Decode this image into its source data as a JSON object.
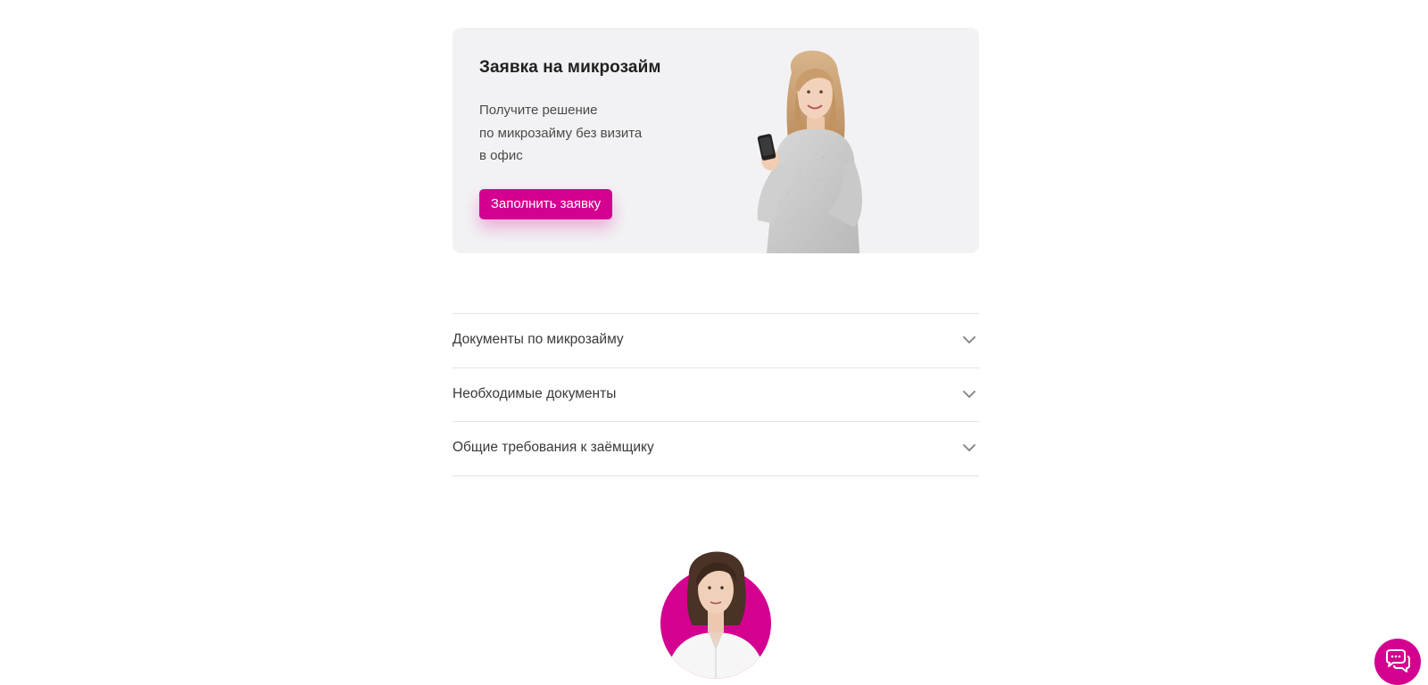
{
  "promo": {
    "title": "Заявка на микрозайм",
    "text_lines": [
      "Получите решение",
      "по микрозайму без визита",
      "в офис"
    ],
    "button_label": "Заполнить заявку",
    "accent_color": "#d4008f",
    "card_background": "#f2f2f4"
  },
  "accordion": {
    "items": [
      {
        "label": "Документы по микрозайму",
        "icon": "chevron-down-icon"
      },
      {
        "label": "Необходимые документы",
        "icon": "chevron-down-icon"
      },
      {
        "label": "Общие требования к заёмщику",
        "icon": "chevron-down-icon"
      }
    ]
  },
  "manager": {
    "icon": "manager-avatar",
    "ring_color": "#d4008f"
  },
  "chat": {
    "icon": "chat-bubbles-icon",
    "color": "#d4008f"
  }
}
